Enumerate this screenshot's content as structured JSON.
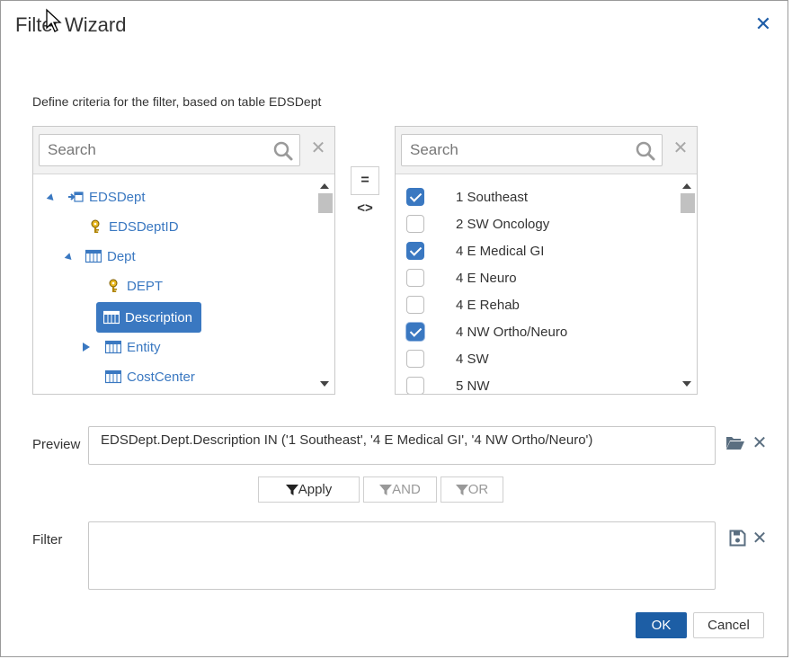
{
  "dialog": {
    "title": "Filter Wizard",
    "criteria_label": "Define criteria for the filter, based on table EDSDept"
  },
  "left_panel": {
    "search_placeholder": "Search",
    "tree": [
      {
        "label": "EDSDept",
        "icon": "table-link-icon",
        "toggle": "expanded"
      },
      {
        "label": "EDSDeptID",
        "icon": "key-icon",
        "toggle": "none"
      },
      {
        "label": "Dept",
        "icon": "table-icon",
        "toggle": "expanded"
      },
      {
        "label": "DEPT",
        "icon": "key-icon",
        "toggle": "none"
      },
      {
        "label": "Description",
        "icon": "table-icon",
        "toggle": "none",
        "selected": true
      },
      {
        "label": "Entity",
        "icon": "table-icon",
        "toggle": "collapsed"
      },
      {
        "label": "CostCenter",
        "icon": "table-icon",
        "toggle": "none"
      }
    ]
  },
  "operators": {
    "equals": "=",
    "not_equals": "<>"
  },
  "right_panel": {
    "search_placeholder": "Search",
    "items": [
      {
        "label": "1 Southeast",
        "checked": true
      },
      {
        "label": "2 SW Oncology",
        "checked": false
      },
      {
        "label": "4 E Medical GI",
        "checked": true
      },
      {
        "label": "4 E Neuro",
        "checked": false
      },
      {
        "label": "4 E Rehab",
        "checked": false
      },
      {
        "label": "4 NW Ortho/Neuro",
        "checked": true
      },
      {
        "label": "4 SW",
        "checked": false
      },
      {
        "label": "5 NW",
        "checked": false
      }
    ]
  },
  "preview": {
    "label": "Preview",
    "text": "EDSDept.Dept.Description IN ('1 Southeast', '4 E Medical GI', '4 NW Ortho/Neuro')"
  },
  "actions": {
    "apply": "Apply",
    "and": "AND",
    "or": "OR"
  },
  "filter": {
    "label": "Filter",
    "text": ""
  },
  "footer": {
    "ok": "OK",
    "cancel": "Cancel"
  },
  "colors": {
    "accent": "#3a78c1",
    "primary_button": "#1d5ea5"
  }
}
